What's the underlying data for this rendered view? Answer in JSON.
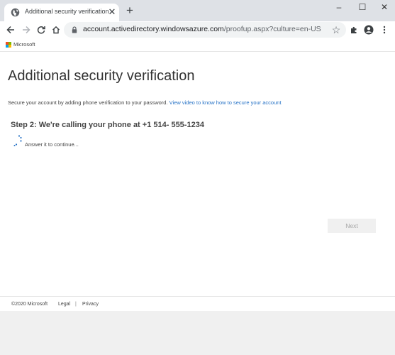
{
  "browser": {
    "tab_title": "Additional security verification",
    "tab_close": "✕",
    "new_tab": "+",
    "window_controls": {
      "minimize": "–",
      "maximize": "☐",
      "close": "✕"
    },
    "url_host": "account.activedirectory.windowsazure.com",
    "url_path": "/proofup.aspx?culture=en-US",
    "icons": [
      "globe-icon",
      "back-icon",
      "forward-icon",
      "reload-icon",
      "home-icon",
      "lock-icon",
      "star-icon",
      "extensions-icon",
      "profile-icon",
      "menu-icon"
    ]
  },
  "header": {
    "brand": "Microsoft"
  },
  "main": {
    "title": "Additional security verification",
    "intro": "Secure your account by adding phone verification to your password.",
    "video_link": "View video to know how to secure your account",
    "step": "Step 2: We're calling your phone at +1 514- 555-1234",
    "status": "Answer it to continue...",
    "next_label": "Next"
  },
  "footer": {
    "copyright": "©2020 Microsoft",
    "legal": "Legal",
    "separator": "|",
    "privacy": "Privacy"
  },
  "colors": {
    "accent": "#2672c6",
    "tabstrip": "#dee1e6",
    "button_disabled_bg": "#f0f0f0",
    "ms_red": "#f25022",
    "ms_green": "#7fba00",
    "ms_blue": "#00a4ef",
    "ms_yellow": "#ffb900"
  }
}
